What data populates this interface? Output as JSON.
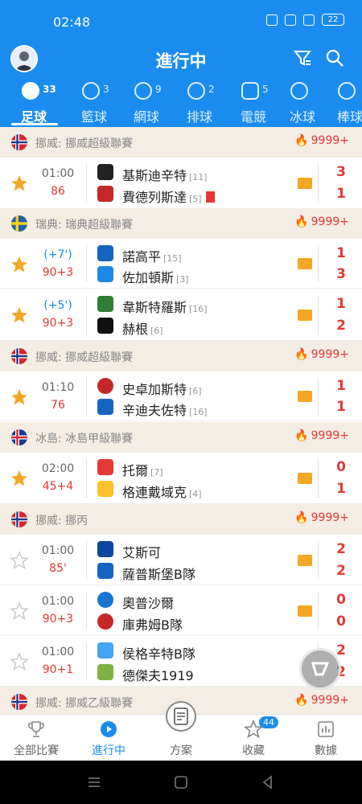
{
  "status": {
    "time": "02:48",
    "battery": "22"
  },
  "header": {
    "title": "進行中"
  },
  "sport_tabs": [
    {
      "label": "足球",
      "count": "33",
      "icon": "soccer-ball-icon",
      "active": true
    },
    {
      "label": "籃球",
      "count": "3",
      "icon": "basketball-icon"
    },
    {
      "label": "網球",
      "count": "9",
      "icon": "tennis-icon"
    },
    {
      "label": "排球",
      "count": "2",
      "icon": "volleyball-icon"
    },
    {
      "label": "電競",
      "count": "5",
      "icon": "gamepad-icon"
    },
    {
      "label": "冰球",
      "count": "",
      "icon": "hockey-puck-icon"
    },
    {
      "label": "棒球",
      "count": "",
      "icon": "baseball-icon"
    }
  ],
  "leagues": [
    {
      "name": "挪威: 挪威超級聯賽",
      "hot": "9999+",
      "flag": "norway"
    },
    {
      "name": "瑞典: 瑞典超級聯賽",
      "hot": "9999+",
      "flag": "sweden"
    },
    {
      "name": "挪威: 挪威超級聯賽",
      "hot": "9999+",
      "flag": "norway"
    },
    {
      "name": "冰島: 冰島甲級聯賽",
      "hot": "9999+",
      "flag": "iceland"
    },
    {
      "name": "挪威: 挪丙",
      "hot": "9999+",
      "flag": "norway"
    },
    {
      "name": "挪威: 挪威乙級聯賽",
      "hot": "9999+",
      "flag": "norway"
    }
  ],
  "matches": [
    {
      "starred": true,
      "time": "01:00",
      "minute": "86",
      "added": "",
      "home": "基斯迪辛特",
      "home_rank": "[11]",
      "away": "費德列斯達",
      "away_rank": "[5]",
      "home_score": "3",
      "away_score": "1",
      "away_red": true
    },
    {
      "starred": true,
      "time": "",
      "added": "(+7')",
      "minute": "90+3",
      "home": "諾高平",
      "home_rank": "[15]",
      "away": "佐加頓斯",
      "away_rank": "[3]",
      "home_score": "1",
      "away_score": "3"
    },
    {
      "starred": true,
      "time": "",
      "added": "(+5')",
      "minute": "90+3",
      "home": "韋斯特羅斯",
      "home_rank": "[16]",
      "away": "赫根",
      "away_rank": "[6]",
      "home_score": "1",
      "away_score": "2"
    },
    {
      "starred": true,
      "time": "01:10",
      "minute": "76",
      "added": "",
      "home": "史卓加斯特",
      "home_rank": "[6]",
      "away": "辛迪夫佐特",
      "away_rank": "[16]",
      "home_score": "1",
      "away_score": "1"
    },
    {
      "starred": true,
      "time": "02:00",
      "minute": "45+4",
      "added": "",
      "home": "托爾",
      "home_rank": "[7]",
      "away": "格連戴域克",
      "away_rank": "[4]",
      "home_score": "0",
      "away_score": "1"
    },
    {
      "starred": false,
      "time": "01:00",
      "minute": "85'",
      "added": "",
      "home": "艾斯可",
      "home_rank": "",
      "away": "薩普斯堡B隊",
      "away_rank": "",
      "home_score": "2",
      "away_score": "2"
    },
    {
      "starred": false,
      "time": "01:00",
      "minute": "90+3",
      "added": "",
      "home": "奧普沙爾",
      "home_rank": "",
      "away": "庫弗姆B隊",
      "away_rank": "",
      "home_score": "0",
      "away_score": "0"
    },
    {
      "starred": false,
      "time": "01:00",
      "minute": "90+1",
      "added": "",
      "home": "侯格辛特B隊",
      "home_rank": "",
      "away": "德傑夫1919",
      "away_rank": "",
      "home_score": "2",
      "away_score": "2"
    }
  ],
  "bottom_nav": [
    {
      "label": "全部比賽",
      "icon": "trophy-icon"
    },
    {
      "label": "進行中",
      "icon": "play-icon",
      "active": true
    },
    {
      "label": "方案",
      "icon": "document-icon"
    },
    {
      "label": "收藏",
      "icon": "star-icon",
      "badge": "44"
    },
    {
      "label": "數據",
      "icon": "chart-icon"
    }
  ],
  "colors": {
    "brand": "#1a8cf0",
    "score": "#e53935",
    "league_bg": "#f3ede4"
  }
}
